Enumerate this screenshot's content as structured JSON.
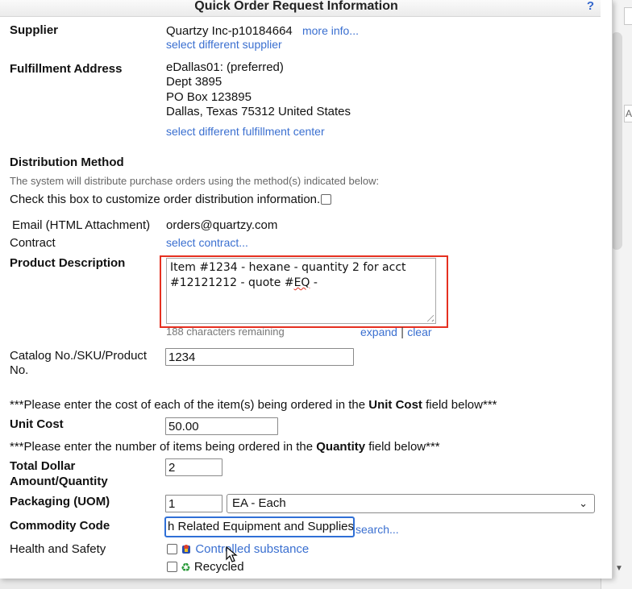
{
  "dialog": {
    "title": "Quick Order Request Information",
    "help": "?"
  },
  "supplier": {
    "label": "Supplier",
    "name": "Quartzy Inc-p10184664",
    "more_info": "more info...",
    "change_link": "select different supplier"
  },
  "fulfillment": {
    "label": "Fulfillment Address",
    "lines": [
      "eDallas01: (preferred)",
      "Dept 3895",
      "PO Box 123895",
      "Dallas, Texas 75312 United States"
    ],
    "change_link": "select different fulfillment center"
  },
  "distribution": {
    "label": "Distribution Method",
    "note": "The system will distribute purchase orders using the method(s) indicated below:",
    "customize_text": "Check this box to customize order distribution information.",
    "method_label": "Email (HTML Attachment)",
    "method_value": "orders@quartzy.com"
  },
  "contract": {
    "label": "Contract",
    "link": "select contract..."
  },
  "product_description": {
    "label": "Product Description",
    "value_pre": "Item #1234 - hexane - quantity 2 for acct #12121212 - quote #",
    "value_flag": "EQ",
    "value_post": " -",
    "chars_remaining": "188 characters remaining",
    "expand": "expand",
    "separator": "|",
    "clear": "clear"
  },
  "catalog": {
    "label_line1": "Catalog No./SKU/Product",
    "label_line2": "No.",
    "value": "1234"
  },
  "unit_cost_note": {
    "pre": "***Please enter the cost of each of the item(s) being ordered in the ",
    "bold": "Unit Cost",
    "post": " field below***"
  },
  "unit_cost": {
    "label": "Unit Cost",
    "value": "50.00"
  },
  "quantity_note": {
    "pre": "***Please enter the number of items being ordered in the ",
    "bold": "Quantity",
    "post": " field below***"
  },
  "quantity": {
    "label_line1": "Total Dollar",
    "label_line2": "Amount/Quantity",
    "value": "2"
  },
  "packaging": {
    "label": "Packaging (UOM)",
    "quantity": "1",
    "uom_selected": "EA - Each"
  },
  "commodity": {
    "label": "Commodity Code",
    "value": "h Related Equipment and Supplies",
    "search_link": "search..."
  },
  "health_safety": {
    "label": "Health and Safety",
    "controlled": "Controlled substance",
    "recycled": "Recycled"
  },
  "background": {
    "fragment": "Ac"
  }
}
